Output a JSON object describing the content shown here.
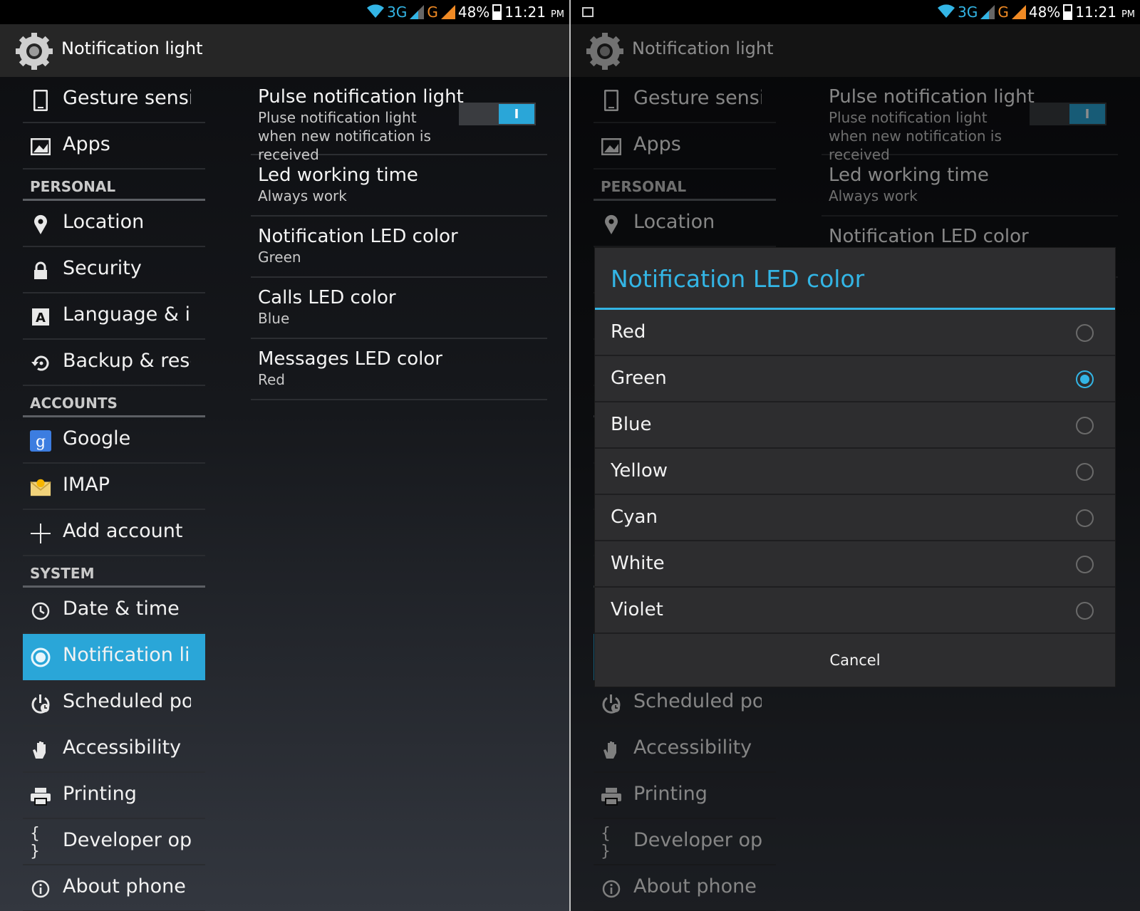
{
  "status": {
    "net1": "3G",
    "net2": "G",
    "battery": "48%",
    "time": "11:21",
    "ampm": "PM"
  },
  "title": "Notification light",
  "sidebar": {
    "items": [
      {
        "icon": "phone-icon",
        "label": "Gesture sensir"
      },
      {
        "icon": "apps-icon",
        "label": "Apps"
      },
      {
        "header": "PERSONAL"
      },
      {
        "icon": "location-pin-icon",
        "label": "Location"
      },
      {
        "icon": "lock-icon",
        "label": "Security"
      },
      {
        "icon": "language-icon",
        "label": "Language & in|"
      },
      {
        "icon": "backup-icon",
        "label": "Backup & rese"
      },
      {
        "header": "ACCOUNTS"
      },
      {
        "icon": "google-icon",
        "label": "Google"
      },
      {
        "icon": "mail-icon",
        "label": "IMAP"
      },
      {
        "icon": "plus-icon",
        "label": "Add account"
      },
      {
        "header": "SYSTEM"
      },
      {
        "icon": "clock-icon",
        "label": "Date & time"
      },
      {
        "icon": "notification-light-icon",
        "label": "Notification lig",
        "active": true
      },
      {
        "icon": "scheduled-power-icon",
        "label": "Scheduled pov"
      },
      {
        "icon": "hand-icon",
        "label": "Accessibility"
      },
      {
        "icon": "printer-icon",
        "label": "Printing"
      },
      {
        "icon": "braces-icon",
        "label": "Developer opti"
      },
      {
        "icon": "info-icon",
        "label": "About phone"
      }
    ]
  },
  "prefs": [
    {
      "title": "Pulse notification light",
      "summary": "Pluse notification light when new notification is received",
      "toggle": "I"
    },
    {
      "title": "Led working time",
      "summary": "Always work"
    },
    {
      "title": "Notification LED color",
      "summary": "Green"
    },
    {
      "title": "Calls LED color",
      "summary": "Blue"
    },
    {
      "title": "Messages LED color",
      "summary": "Red"
    }
  ],
  "dialog": {
    "title": "Notification LED color",
    "options": [
      "Red",
      "Green",
      "Blue",
      "Yellow",
      "Cyan",
      "White",
      "Violet"
    ],
    "selected": "Green",
    "cancel": "Cancel"
  },
  "colors": {
    "accent": "#33b5e5",
    "active_row": "#2aa6d8"
  }
}
